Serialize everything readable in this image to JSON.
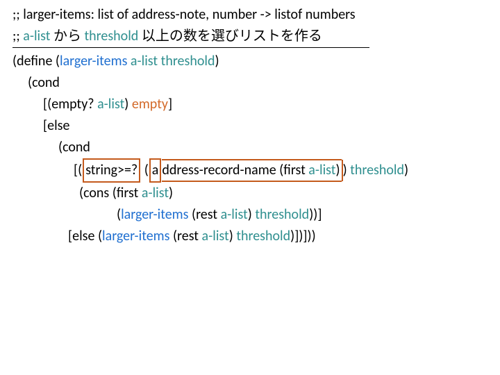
{
  "comments": {
    "line1": ";; larger-items: list of address-note, number -> listof numbers",
    "line2_prefix": ";; ",
    "line2_a": "a-list",
    "line2_mid": " から ",
    "line2_b": "threshold",
    "line2_suffix": " 以上の数を選びリストを作る"
  },
  "code": {
    "l1_a": "(define (",
    "l1_fn": "larger-items",
    "l1_b": " ",
    "l1_arg1": "a-list",
    "l1_c": " ",
    "l1_arg2": "threshold",
    "l1_d": ")",
    "l2": "(cond",
    "l3_a": "[(empty? ",
    "l3_arg": "a-list",
    "l3_b": ") ",
    "l3_empty": "empty",
    "l3_c": "]",
    "l4": "[else",
    "l5": "(cond",
    "l6_a": "[(",
    "l6_box1": "string>=?",
    "l6_b": " (",
    "l6_box2a": "a",
    "l6_box2b": "ddress-record-name (first ",
    "l6_arg": "a-list",
    "l6_c": ")",
    "l6_d": ") ",
    "l6_th": "threshold",
    "l6_e": ")",
    "l7_a": "(cons (first ",
    "l7_arg": "a-list",
    "l7_b": ")",
    "l8_a": "(",
    "l8_fn": "larger-items",
    "l8_b": " (rest ",
    "l8_arg": "a-list",
    "l8_c": ") ",
    "l8_th": "threshold",
    "l8_d": "))]",
    "l9_a": "[else (",
    "l9_fn": "larger-items",
    "l9_b": " (rest ",
    "l9_arg": "a-list",
    "l9_c": ") ",
    "l9_th": "threshold",
    "l9_d": ")])]))"
  }
}
